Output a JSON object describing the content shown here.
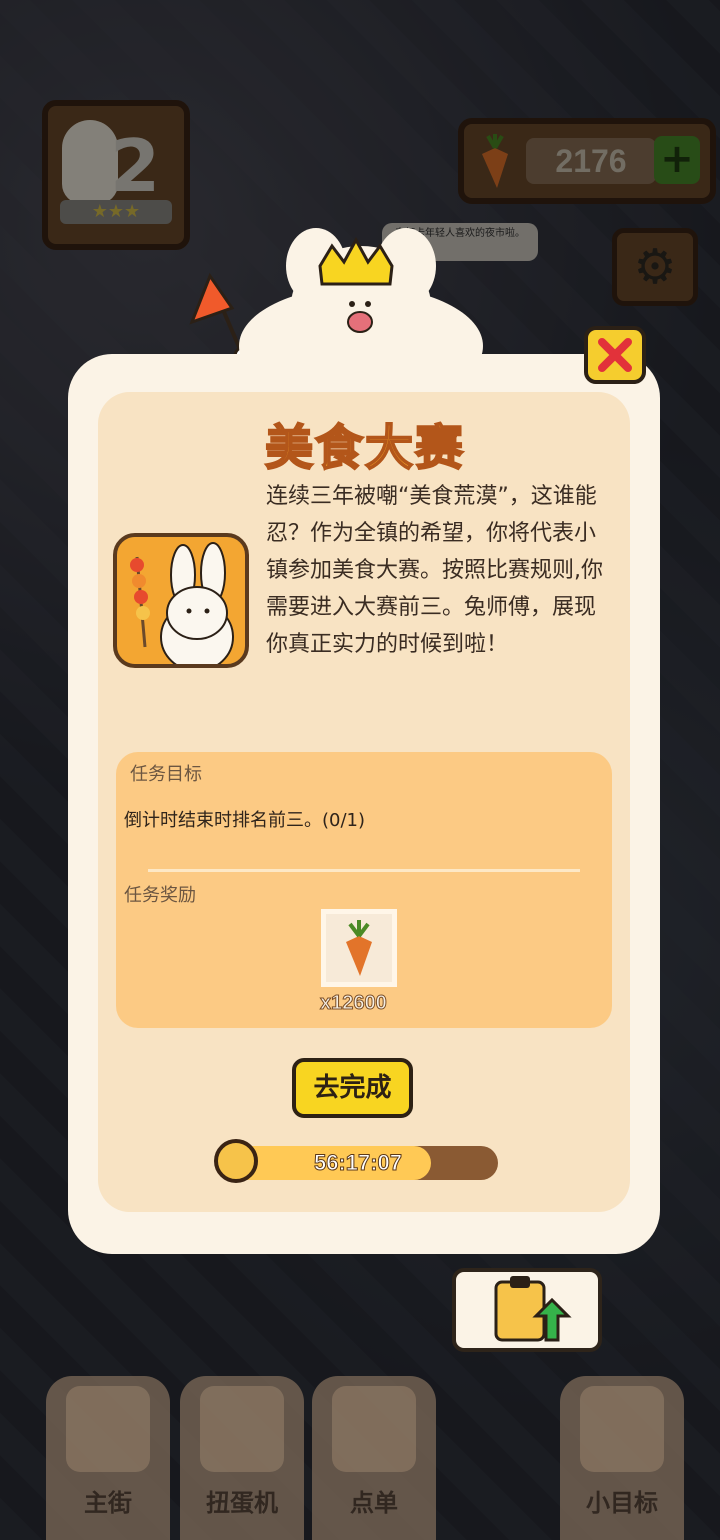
{
  "hud": {
    "level_number": "2",
    "stars": "★★★",
    "currency_value": "2176",
    "plus_symbol": "+",
    "npc_bubble": "来打卡年轻人喜欢的夜市啦。"
  },
  "dialog": {
    "title": "美食大赛",
    "story": "连续三年被嘲“美食荒漠”，这谁能忍？作为全镇的希望，你将代表小镇参加美食大赛。按照比赛规则,你需要进入大赛前三。兔师傅，展现你真正实力的时候到啦！",
    "task_title": "任务目标",
    "task_desc": "倒计时结束时排名前三。(0/1)",
    "reward_title": "任务奖励",
    "reward_icon": "carrot-icon",
    "reward_count": "x12600",
    "action_button": "去完成",
    "timer": "56:17:07",
    "timer_fraction": 0.76
  },
  "nav": {
    "tabs": [
      {
        "label": "主街",
        "icon": "map-icon"
      },
      {
        "label": "扭蛋机",
        "icon": "gacha-icon"
      },
      {
        "label": "点单",
        "icon": "order-icon"
      },
      {
        "label": "小目标",
        "icon": "goal-icon"
      }
    ]
  },
  "colors": {
    "panel": "#fbf3e6",
    "panel_inner": "#f8e3c3",
    "task_box": "#fcca84",
    "accent_yellow": "#f8d521",
    "title_orange": "#f2a22a"
  }
}
